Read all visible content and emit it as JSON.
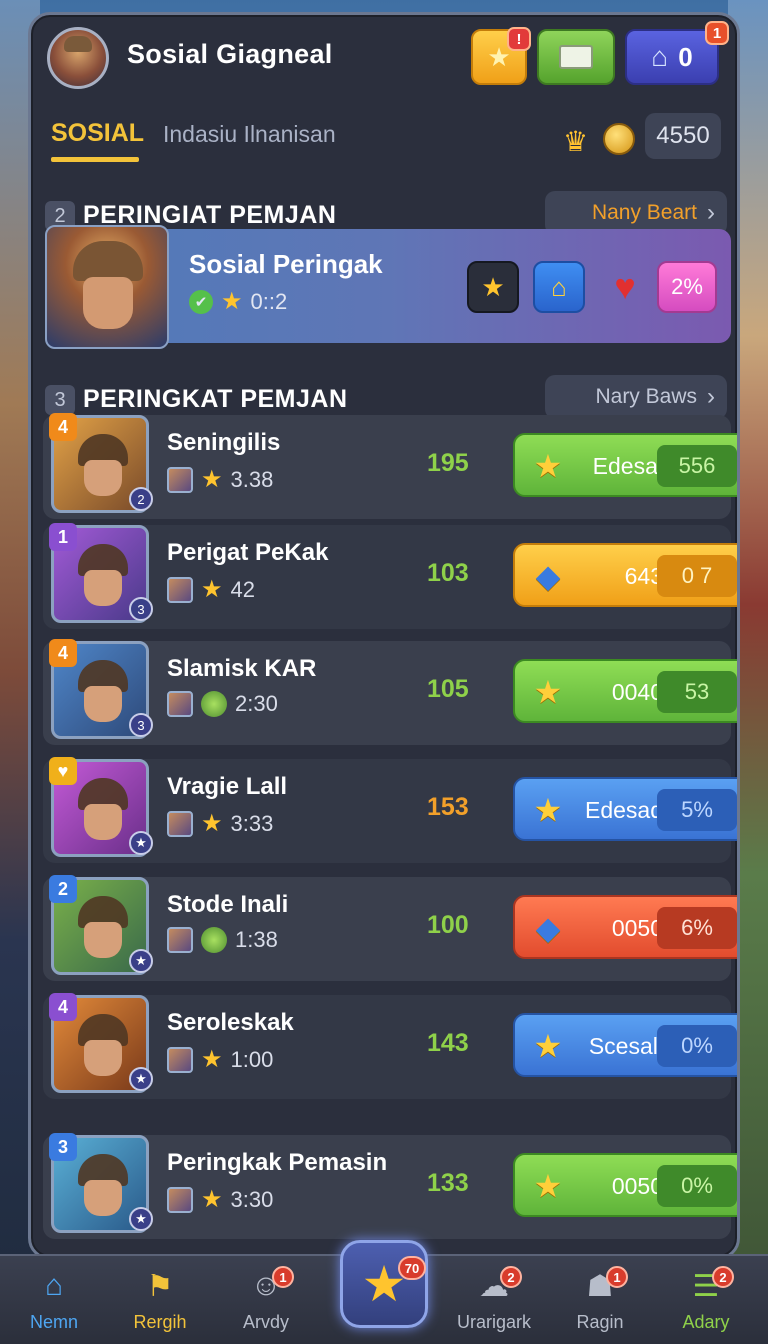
{
  "header": {
    "title": "Sosial Giagneal",
    "buttons": [
      {
        "icon": "star-icon",
        "badge": "!"
      },
      {
        "icon": "box-icon"
      },
      {
        "icon": "home-icon",
        "value": "0",
        "badge": "1"
      }
    ]
  },
  "tabs": {
    "active": "SOSIAL",
    "inactive": "Indasiu Ilnanisan",
    "currency_value": "4550"
  },
  "section1": {
    "number": "2",
    "title": "PERINGIAT PEMJAN",
    "button_label": "Nany Beart",
    "button_color": "#f2a02a"
  },
  "featured": {
    "title": "Sosial Peringak",
    "stat": "0::2",
    "badge_percent": "2%"
  },
  "section2": {
    "number": "3",
    "title": "PERINGKAT PEMJAN",
    "button_label": "Nary Baws"
  },
  "players": [
    {
      "rank": "4",
      "rank_color": "#f08a1a",
      "level": "2",
      "name": "Seningilis",
      "stat": "3.38",
      "score": "195",
      "score_color": "green",
      "action_color": "green",
      "action_icon": "star",
      "action_label": "Edesal",
      "action_value": "556",
      "bg": "linear-gradient(135deg,#e2a247,#7a4b2a)"
    },
    {
      "rank": "1",
      "rank_color": "#8a4fd0",
      "level": "3",
      "name": "Perigat PeKak",
      "stat": "42",
      "score": "103",
      "score_color": "green",
      "action_color": "yellow",
      "action_icon": "diamond",
      "action_label": "643",
      "action_value": "0 7",
      "bg": "linear-gradient(135deg,#a25ad6,#4a3a8a)"
    },
    {
      "rank": "4",
      "rank_color": "#f08a1a",
      "level": "3",
      "name": "Slamisk KAR",
      "stat": "2:30",
      "score": "105",
      "score_color": "green",
      "action_color": "green",
      "action_icon": "star",
      "action_label": "0040",
      "action_value": "53",
      "bg": "linear-gradient(135deg,#4f86c9,#2e4a7a)"
    },
    {
      "rank": "♥",
      "rank_color": "#f0b01a",
      "level": "★",
      "name": "Vragie Lall",
      "stat": "3:33",
      "score": "153",
      "score_color": "orange",
      "action_color": "blue",
      "action_icon": "star",
      "action_label": "Edesad",
      "action_value": "5%",
      "bg": "linear-gradient(135deg,#c35ad6,#6a2f8a)"
    },
    {
      "rank": "2",
      "rank_color": "#3a7be0",
      "level": "★",
      "name": "Stode Inali",
      "stat": "1:38",
      "score": "100",
      "score_color": "green",
      "action_color": "red",
      "action_icon": "diamond",
      "action_label": "0050",
      "action_value": "6%",
      "bg": "linear-gradient(135deg,#7ab04a,#3a6a4a)"
    },
    {
      "rank": "4",
      "rank_color": "#8a4fd0",
      "level": "★",
      "name": "Seroleskak",
      "stat": "1:00",
      "score": "143",
      "score_color": "green",
      "action_color": "blue",
      "action_icon": "star",
      "action_label": "Scesall",
      "action_value": "0%",
      "bg": "linear-gradient(135deg,#e28a3a,#7a3a1a)"
    },
    {
      "rank": "3",
      "rank_color": "#3a7be0",
      "level": "★",
      "name": "Peringkak Pemasin",
      "stat": "3:30",
      "score": "133",
      "score_color": "green",
      "action_color": "green",
      "action_icon": "star",
      "action_label": "0050",
      "action_value": "0%",
      "bg": "linear-gradient(135deg,#5ab0d6,#2a5a8a)"
    }
  ],
  "bottom_nav": [
    {
      "label": "Nemn",
      "color": "#4ea6f2",
      "badge": ""
    },
    {
      "label": "Rergih",
      "color": "#f2c33a",
      "badge": ""
    },
    {
      "label": "Arvdy",
      "color": "#b7bdca",
      "badge": "1"
    },
    {
      "label": "",
      "color": "#ffc42e",
      "badge": "70"
    },
    {
      "label": "Urarigark",
      "color": "#b7bdca",
      "badge": "2"
    },
    {
      "label": "Ragin",
      "color": "#b7bdca",
      "badge": "1"
    },
    {
      "label": "Adary",
      "color": "#8fd14a",
      "badge": "2"
    }
  ]
}
